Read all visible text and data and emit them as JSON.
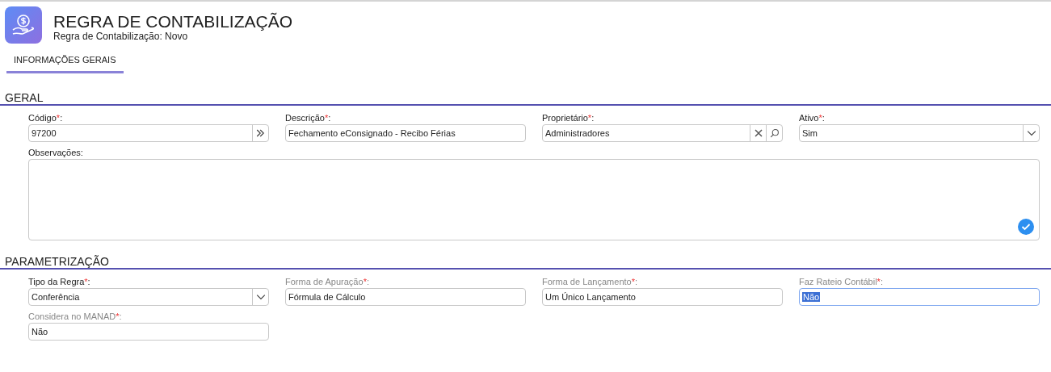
{
  "header": {
    "title": "REGRA DE CONTABILIZAÇÃO",
    "subtitle": "Regra de Contabilização: Novo"
  },
  "tabs": [
    {
      "label": "INFORMAÇÕES GERAIS",
      "selected": true
    }
  ],
  "sections": [
    {
      "title": "GERAL",
      "fields": [
        {
          "label": "Código",
          "required_mark": "*",
          "label_end": ":",
          "kind": "lookup",
          "value": "97200",
          "disabled": false
        },
        {
          "label": "Descrição",
          "required_mark": "*",
          "label_end": ":",
          "kind": "text",
          "value": "Fechamento eConsignado - Recibo Férias",
          "disabled": false
        },
        {
          "label": "Proprietário",
          "required_mark": "*",
          "label_end": ":",
          "kind": "search",
          "value": "Administradores",
          "disabled": false
        },
        {
          "label": "Ativo",
          "required_mark": "*",
          "label_end": ":",
          "kind": "select",
          "value": "Sim",
          "disabled": false
        },
        {
          "label": "Observações",
          "label_end": ":",
          "kind": "textarea",
          "disabled": false
        }
      ]
    },
    {
      "title": "PARAMETRIZAÇÃO",
      "fields": [
        {
          "label": "Tipo da Regra",
          "required_mark": "*",
          "label_end": ":",
          "kind": "select",
          "value": "Conferência",
          "disabled": false
        },
        {
          "label": "Forma de Apuração",
          "required_mark": "*",
          "label_end": ":",
          "kind": "text",
          "value": "Fórmula de Cálculo",
          "disabled": true
        },
        {
          "label": "Forma de Lançamento",
          "required_mark": "*",
          "label_end": ":",
          "kind": "text",
          "value": "Um Único Lançamento",
          "disabled": true
        },
        {
          "label": "Faz Rateio Contábil",
          "required_mark": "*",
          "label_end": ":",
          "kind": "text",
          "value": "Não",
          "disabled": true,
          "focused": true
        },
        {
          "label": "Considera no MANAD",
          "required_mark": "*",
          "label_end": ":",
          "kind": "text",
          "value": "Não",
          "disabled": true
        }
      ]
    }
  ]
}
